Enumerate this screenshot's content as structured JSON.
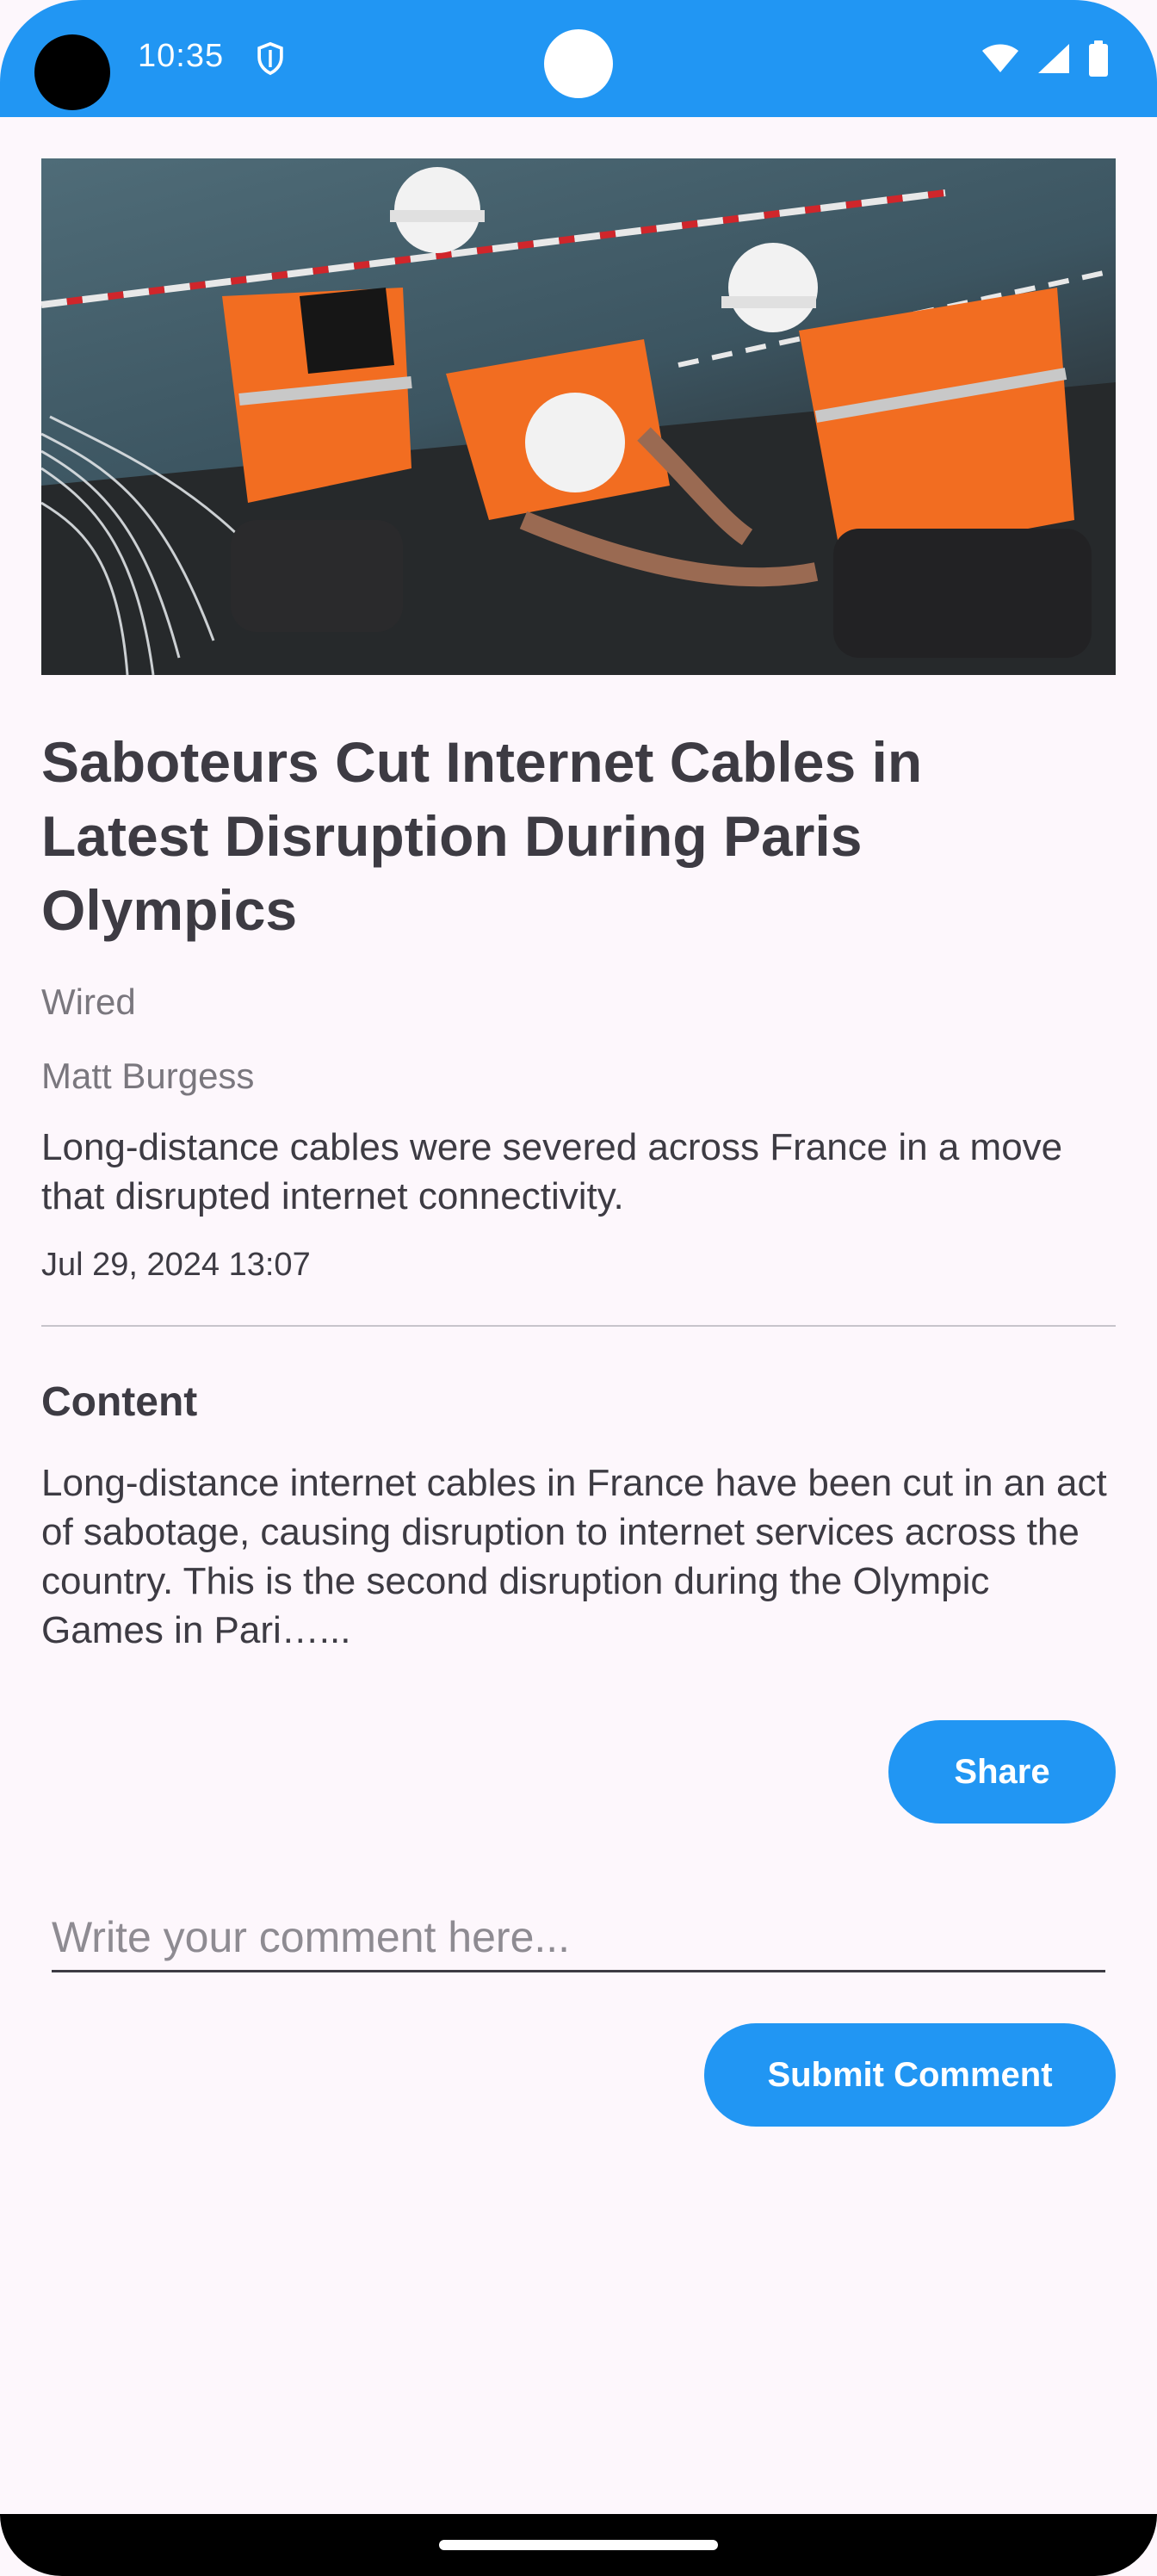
{
  "status_bar": {
    "time": "10:35",
    "icons": [
      "shield-icon",
      "wifi-icon",
      "signal-icon",
      "battery-icon"
    ]
  },
  "article": {
    "image": "construction-workers-photo",
    "title": "Saboteurs Cut Internet Cables in Latest Disruption During Paris Olympics",
    "source": "Wired",
    "author": "Matt Burgess",
    "description": "Long-distance cables were severed across France in a move that disrupted internet connectivity.",
    "date": "Jul 29, 2024 13:07",
    "content_heading": "Content",
    "content_body": "Long-distance internet cables in France have been cut in an act of sabotage, causing disruption to internet services across the country. This is the second disruption during the Olympic Games in Pari…..."
  },
  "actions": {
    "share_label": "Share",
    "comment_placeholder": "Write your comment here...",
    "submit_label": "Submit Comment"
  },
  "colors": {
    "accent": "#2196f3",
    "background": "#fdf7fc",
    "text": "#3d3b43",
    "muted": "#7a777e"
  }
}
